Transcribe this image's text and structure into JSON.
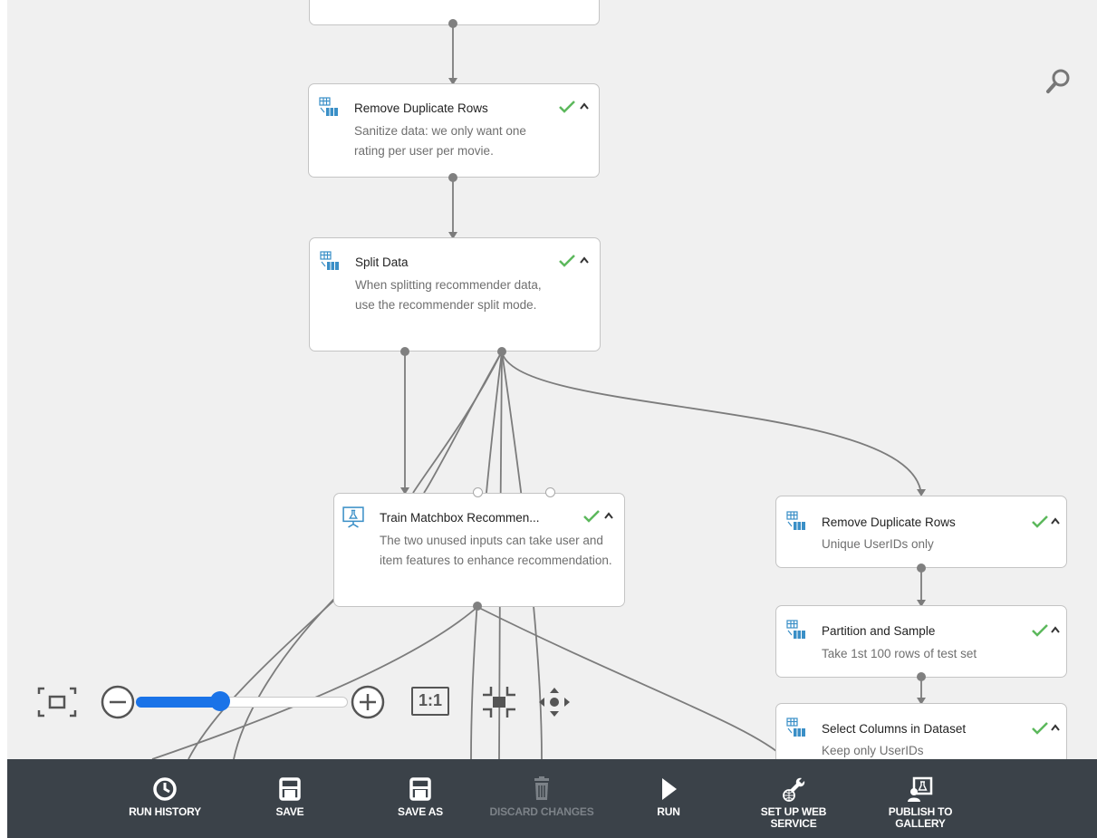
{
  "nodes": {
    "top_partial": {},
    "remove_dup_1": {
      "title": "Remove Duplicate Rows",
      "description": "Sanitize data: we only want one rating per user per movie.",
      "icon": "table-transform-icon",
      "status": "success"
    },
    "split_data": {
      "title": "Split Data",
      "description": "When splitting recommender data, use the recommender split mode.",
      "icon": "table-transform-icon",
      "status": "success"
    },
    "train_matchbox": {
      "title": "Train Matchbox Recommen...",
      "description": "The two unused inputs can take user and item features to enhance recommendation.",
      "icon": "train-model-icon",
      "status": "success"
    },
    "remove_dup_2": {
      "title": "Remove Duplicate Rows",
      "description": "Unique UserIDs only",
      "icon": "table-transform-icon",
      "status": "success"
    },
    "partition_sample": {
      "title": "Partition and Sample",
      "description": "Take 1st 100 rows of test set",
      "icon": "table-transform-icon",
      "status": "success"
    },
    "select_columns": {
      "title": "Select Columns in Dataset",
      "description": "Keep only UserIDs",
      "icon": "table-transform-icon",
      "status": "success"
    }
  },
  "zoom": {
    "level": 0.4,
    "actual_size_label": "1:1"
  },
  "toolbar": {
    "run_history": "RUN HISTORY",
    "save": "SAVE",
    "save_as": "SAVE AS",
    "discard_changes": "DISCARD CHANGES",
    "run": "RUN",
    "setup_web_service_1": "SET UP WEB",
    "setup_web_service_2": "SERVICE",
    "publish_gallery_1": "PUBLISH TO",
    "publish_gallery_2": "GALLERY"
  },
  "colors": {
    "toolbar_bg": "#3b4249",
    "canvas_bg": "#f0f0f0",
    "accent_blue": "#1a73e8",
    "success_green": "#5cb85c",
    "icon_blue": "#3a8fc7"
  }
}
